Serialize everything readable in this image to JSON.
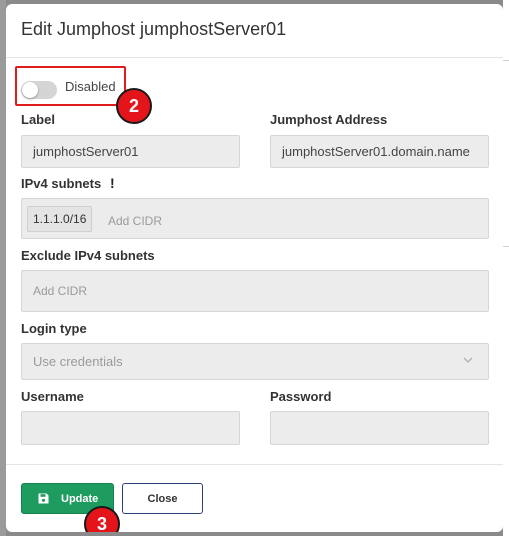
{
  "modal": {
    "title": "Edit Jumphost jumphostServer01"
  },
  "toggle": {
    "label": "Disabled",
    "state": "off"
  },
  "annotations": {
    "toggle_marker": "2",
    "update_marker": "3"
  },
  "fields": {
    "label": {
      "label": "Label",
      "value": "jumphostServer01"
    },
    "address": {
      "label": "Jumphost Address",
      "value": "jumphostServer01.domain.name"
    },
    "ipv4": {
      "label": "IPv4 subnets",
      "warning": "!",
      "chips": [
        "1.1.1.0/16"
      ],
      "placeholder": "Add CIDR"
    },
    "exclude_ipv4": {
      "label": "Exclude IPv4 subnets",
      "placeholder": "Add CIDR"
    },
    "login_type": {
      "label": "Login type",
      "value": "Use credentials"
    },
    "username": {
      "label": "Username",
      "value": ""
    },
    "password": {
      "label": "Password",
      "value": ""
    }
  },
  "footer": {
    "update_label": "Update",
    "close_label": "Close"
  },
  "colors": {
    "accent_green": "#1e9b5f",
    "marker_red": "#e3151a",
    "highlight_red": "#e01c1c",
    "close_border": "#2a3f7a"
  },
  "icons": {
    "update": "save-icon",
    "login_type_dropdown": "chevron-down-icon"
  }
}
